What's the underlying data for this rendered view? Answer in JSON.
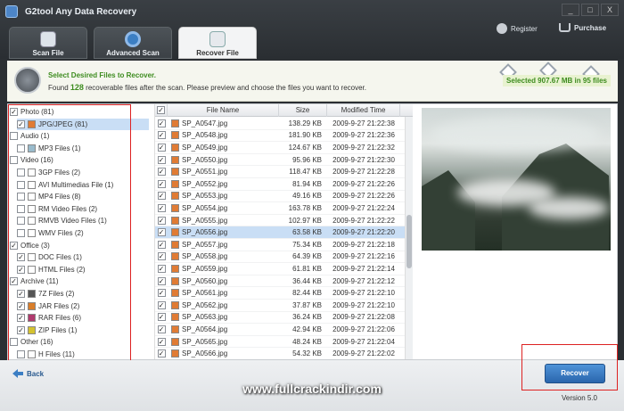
{
  "window": {
    "title": "G2tool Any Data Recovery",
    "controls": [
      "_",
      "□",
      "X"
    ]
  },
  "header": {
    "register_label": "Register",
    "purchase_label": "Purchase"
  },
  "tabs": [
    {
      "label": "Scan File",
      "icon": "scan-file-icon"
    },
    {
      "label": "Advanced Scan",
      "icon": "gear-icon"
    },
    {
      "label": "Recover File",
      "icon": "recover-file-icon",
      "active": true
    }
  ],
  "info": {
    "title": "Select Desired Files to Recover.",
    "text_prefix": "Found ",
    "count": "128",
    "text_suffix": " recoverable files after the scan. Please preview and choose the files you want to recover.",
    "selected": "Selected 907.67 MB in 95 files"
  },
  "tree": [
    {
      "label": "Photo (81)",
      "level": 0,
      "checked": true
    },
    {
      "label": "JPG/JPEG (81)",
      "level": 1,
      "checked": true,
      "selected": true,
      "icon": "jpg"
    },
    {
      "label": "Audio (1)",
      "level": 0,
      "checked": false
    },
    {
      "label": "MP3 Files (1)",
      "level": 1,
      "checked": false,
      "icon": "mp3"
    },
    {
      "label": "Video (16)",
      "level": 0,
      "checked": false
    },
    {
      "label": "3GP Files (2)",
      "level": 1,
      "checked": false,
      "icon": "doc"
    },
    {
      "label": "AVI Multimedias File (1)",
      "level": 1,
      "checked": false,
      "icon": "doc"
    },
    {
      "label": "MP4 Files (8)",
      "level": 1,
      "checked": false,
      "icon": "doc"
    },
    {
      "label": "RM Video Files (2)",
      "level": 1,
      "checked": false,
      "icon": "doc"
    },
    {
      "label": "RMVB Video Files (1)",
      "level": 1,
      "checked": false,
      "icon": "doc"
    },
    {
      "label": "WMV Files (2)",
      "level": 1,
      "checked": false,
      "icon": "doc"
    },
    {
      "label": "Office (3)",
      "level": 0,
      "checked": true
    },
    {
      "label": "DOC Files (1)",
      "level": 1,
      "checked": true,
      "icon": "doc"
    },
    {
      "label": "HTML Files (2)",
      "level": 1,
      "checked": true,
      "icon": "doc"
    },
    {
      "label": "Archive (11)",
      "level": 0,
      "checked": true
    },
    {
      "label": "7Z Files (2)",
      "level": 1,
      "checked": true,
      "icon": "z7"
    },
    {
      "label": "JAR Files (2)",
      "level": 1,
      "checked": true,
      "icon": "jar"
    },
    {
      "label": "RAR Files (6)",
      "level": 1,
      "checked": true,
      "icon": "rar"
    },
    {
      "label": "ZIP Files (1)",
      "level": 1,
      "checked": true,
      "icon": "zip"
    },
    {
      "label": "Other (16)",
      "level": 0,
      "checked": false
    },
    {
      "label": "H Files (11)",
      "level": 1,
      "checked": false,
      "icon": "doc"
    }
  ],
  "table": {
    "headers": [
      "File Name",
      "Size",
      "Modified Time"
    ],
    "rows": [
      {
        "name": "SP_A0547.jpg",
        "size": "138.29 KB",
        "time": "2009-9-27 21:22:38"
      },
      {
        "name": "SP_A0548.jpg",
        "size": "181.90 KB",
        "time": "2009-9-27 21:22:36"
      },
      {
        "name": "SP_A0549.jpg",
        "size": "124.67 KB",
        "time": "2009-9-27 21:22:32"
      },
      {
        "name": "SP_A0550.jpg",
        "size": "95.96 KB",
        "time": "2009-9-27 21:22:30"
      },
      {
        "name": "SP_A0551.jpg",
        "size": "118.47 KB",
        "time": "2009-9-27 21:22:28"
      },
      {
        "name": "SP_A0552.jpg",
        "size": "81.94 KB",
        "time": "2009-9-27 21:22:26"
      },
      {
        "name": "SP_A0553.jpg",
        "size": "49.16 KB",
        "time": "2009-9-27 21:22:26"
      },
      {
        "name": "SP_A0554.jpg",
        "size": "163.78 KB",
        "time": "2009-9-27 21:22:24"
      },
      {
        "name": "SP_A0555.jpg",
        "size": "102.97 KB",
        "time": "2009-9-27 21:22:22"
      },
      {
        "name": "SP_A0556.jpg",
        "size": "63.58 KB",
        "time": "2009-9-27 21:22:20",
        "selected": true
      },
      {
        "name": "SP_A0557.jpg",
        "size": "75.34 KB",
        "time": "2009-9-27 21:22:18"
      },
      {
        "name": "SP_A0558.jpg",
        "size": "64.39 KB",
        "time": "2009-9-27 21:22:16"
      },
      {
        "name": "SP_A0559.jpg",
        "size": "61.81 KB",
        "time": "2009-9-27 21:22:14"
      },
      {
        "name": "SP_A0560.jpg",
        "size": "36.44 KB",
        "time": "2009-9-27 21:22:12"
      },
      {
        "name": "SP_A0561.jpg",
        "size": "82.44 KB",
        "time": "2009-9-27 21:22:10"
      },
      {
        "name": "SP_A0562.jpg",
        "size": "37.87 KB",
        "time": "2009-9-27 21:22:10"
      },
      {
        "name": "SP_A0563.jpg",
        "size": "36.24 KB",
        "time": "2009-9-27 21:22:08"
      },
      {
        "name": "SP_A0564.jpg",
        "size": "42.94 KB",
        "time": "2009-9-27 21:22:06"
      },
      {
        "name": "SP_A0565.jpg",
        "size": "48.24 KB",
        "time": "2009-9-27 21:22:04"
      },
      {
        "name": "SP_A0566.jpg",
        "size": "54.32 KB",
        "time": "2009-9-27 21:22:02"
      }
    ]
  },
  "footer": {
    "back_label": "Back",
    "watermark": "www.fullcrackindir.com",
    "recover_label": "Recover",
    "version": "Version 5.0"
  }
}
